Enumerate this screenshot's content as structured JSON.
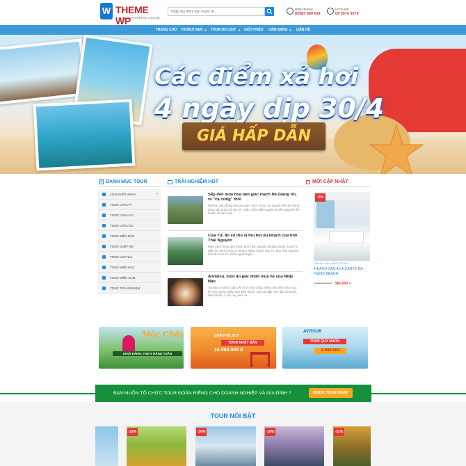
{
  "header": {
    "logo_main": "THEME WP",
    "logo_sub": "THEME WORDPRESS ONLINE",
    "search_placeholder": "Nhập địa điểm bạn muốn đi...",
    "contacts": [
      {
        "label": "ĐIỆN THOẠI",
        "number": "02583 690 514"
      },
      {
        "label": "HOTLINE",
        "number": "09 3574 3575"
      }
    ]
  },
  "nav": [
    "TRANG CHỦ",
    "KHÁCH SẠN",
    "TOUR DU LỊCH",
    "GIỚI THIỆU",
    "CẨM NANG",
    "LIÊN HỆ"
  ],
  "hero": {
    "line1": "Các điểm xả hơi",
    "line2": "4 ngày dịp 30/4",
    "line3": "GIÁ HẤP DẪN"
  },
  "categories": {
    "title": "DANH MỤC TOUR",
    "items": [
      "LỊCH KHỞI HÀNH",
      "TOUR CHÂU Á",
      "TOUR CHÂU ÂU",
      "TOUR CHÂU ÚC",
      "TOUR BIỂN ĐẢO",
      "TOUR GHÉP XE",
      "TOUR LEO NÚI",
      "TOUR MIỀN BẮC",
      "TOUR MIỀN NAM",
      "TOUR TRẢI NGHIỆM"
    ]
  },
  "experiences": {
    "title": "TRẢI NGHIỆM HOT",
    "items": [
      {
        "title": "Sắp đến mùa hoa tam giác mạch Hà Giang rồi, rủ \"cạ cứng\" thôi",
        "desc": "Những cánh đồng hoa tam giác mạch vùng cao nguyên đá Hà Giang đang sắp bung nở rực rỡ, chắc chắn nhiều người sẽ sẵn sàng lên kế hoạch để làm một..."
      },
      {
        "title": "Cửa Tử, ẩn số thú vị thu hút du khách của tỉnh Thái Nguyên",
        "desc": "Nằm cách trung tâm thành phố Thái Nguyên khoảng 45km, Cửa Tử nằm ẩn mình trong xã Hoàng Nông, huyện Đại Từ, tỉnh Thái Nguyên. Cái tên Cửa Tử khiến người nghe..."
      },
      {
        "title": "Anmitsu, món ăn giải nhiệt mùa hè của Nhật Bản",
        "desc": "Anmitsu Anmitsu (あんみつ) là món tráng miệng yêu thích vào mùa hè của người Nhật. Bao gồm thạch, các loại đậu như đậu đỏ azuki, đậu Hà lan, 3 trái cây, kem và..."
      }
    ]
  },
  "updates": {
    "title": "MỚI CẬP NHẬT",
    "badge": "-9%",
    "category": "KHÁCH SẠN, MIỀN TRUNG",
    "name": "KHÁCH SẠN A LA CARTE ĐÀ NẴNG BEACH",
    "old_price": "1.080.000 ₫",
    "new_price": "981.000 ₫"
  },
  "banners": {
    "b1": {
      "title": "Mộc Châu",
      "caption": "KHỞI HÀNH: THỨ 6 HẰNG TUẦN"
    },
    "b2": {
      "top": "CHÀO HÈ 2017",
      "mid": "TOUR NHẬT BẢN",
      "price": "24.990.000 đ"
    },
    "b3": {
      "brand": "AVITOUR",
      "label": "TOUR QUY NHƠN",
      "price": "2.650.000"
    }
  },
  "cta": {
    "text": "BẠN MUỐN TỔ CHỨC TOUR ĐOÀN RIÊNG CHO DOANH NGHIỆP VÀ GIA ĐÌNH ?",
    "button": "BOOK TOUR NGAY"
  },
  "featured": {
    "title": "TOUR NỔI BẬT",
    "badges": [
      "-22%",
      "-16%",
      "-16%",
      "-31%"
    ]
  },
  "colors": {
    "nav": "#3d9bd9",
    "accent": "#1e88e5",
    "cta": "#15913b",
    "sale": "#e53935"
  }
}
